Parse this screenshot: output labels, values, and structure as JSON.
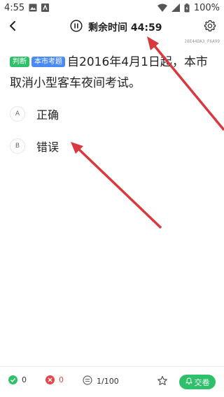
{
  "status_bar": {
    "time": "4:55",
    "battery": "100%"
  },
  "header": {
    "timer_label": "剩余时间 44:59"
  },
  "question": {
    "id": "28E44DA3_F6A99",
    "tags": [
      "判断",
      "本市考题"
    ],
    "text": "自2016年4月1日起，本市取消小型客车夜间考试。"
  },
  "options": [
    {
      "letter": "A",
      "text": "正确"
    },
    {
      "letter": "B",
      "text": "错误"
    }
  ],
  "bottom_bar": {
    "correct_count": "0",
    "wrong_count": "0",
    "progress": "1/100",
    "submit_label": "交卷"
  },
  "colors": {
    "accent_green": "#2ec06a",
    "tag_blue": "#4a8af4",
    "wrong_red": "#e8454a",
    "annotation_red": "#d9383d"
  }
}
